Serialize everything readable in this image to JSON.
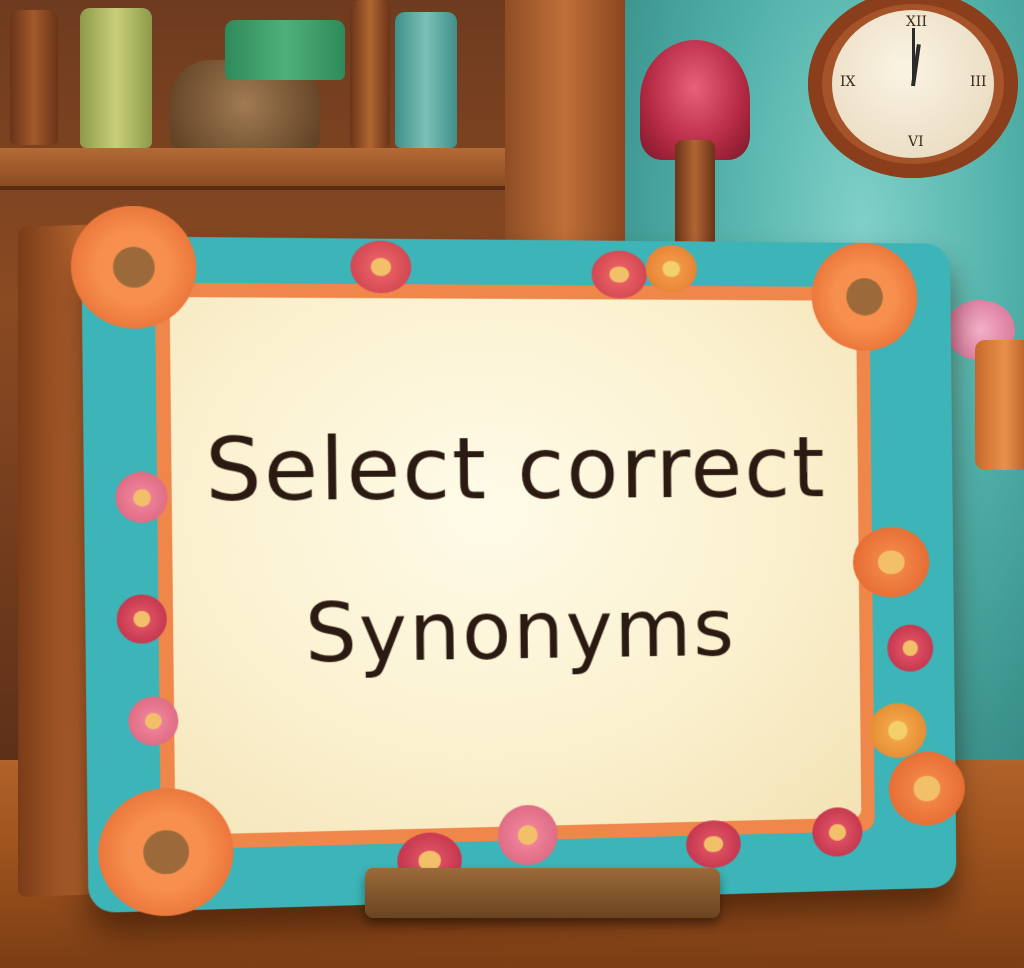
{
  "sign": {
    "line1": "Select correct",
    "line2": "Synonyms"
  },
  "colors": {
    "frame_teal": "#3db4b8",
    "frame_orange": "#f0874a",
    "board_cream": "#fbf1cf",
    "text_dark": "#2a1a12",
    "wall_teal": "#4fb0a8",
    "wood": "#a0541e"
  },
  "icons": [
    "clock-icon",
    "flower-icon",
    "lamp-icon"
  ]
}
